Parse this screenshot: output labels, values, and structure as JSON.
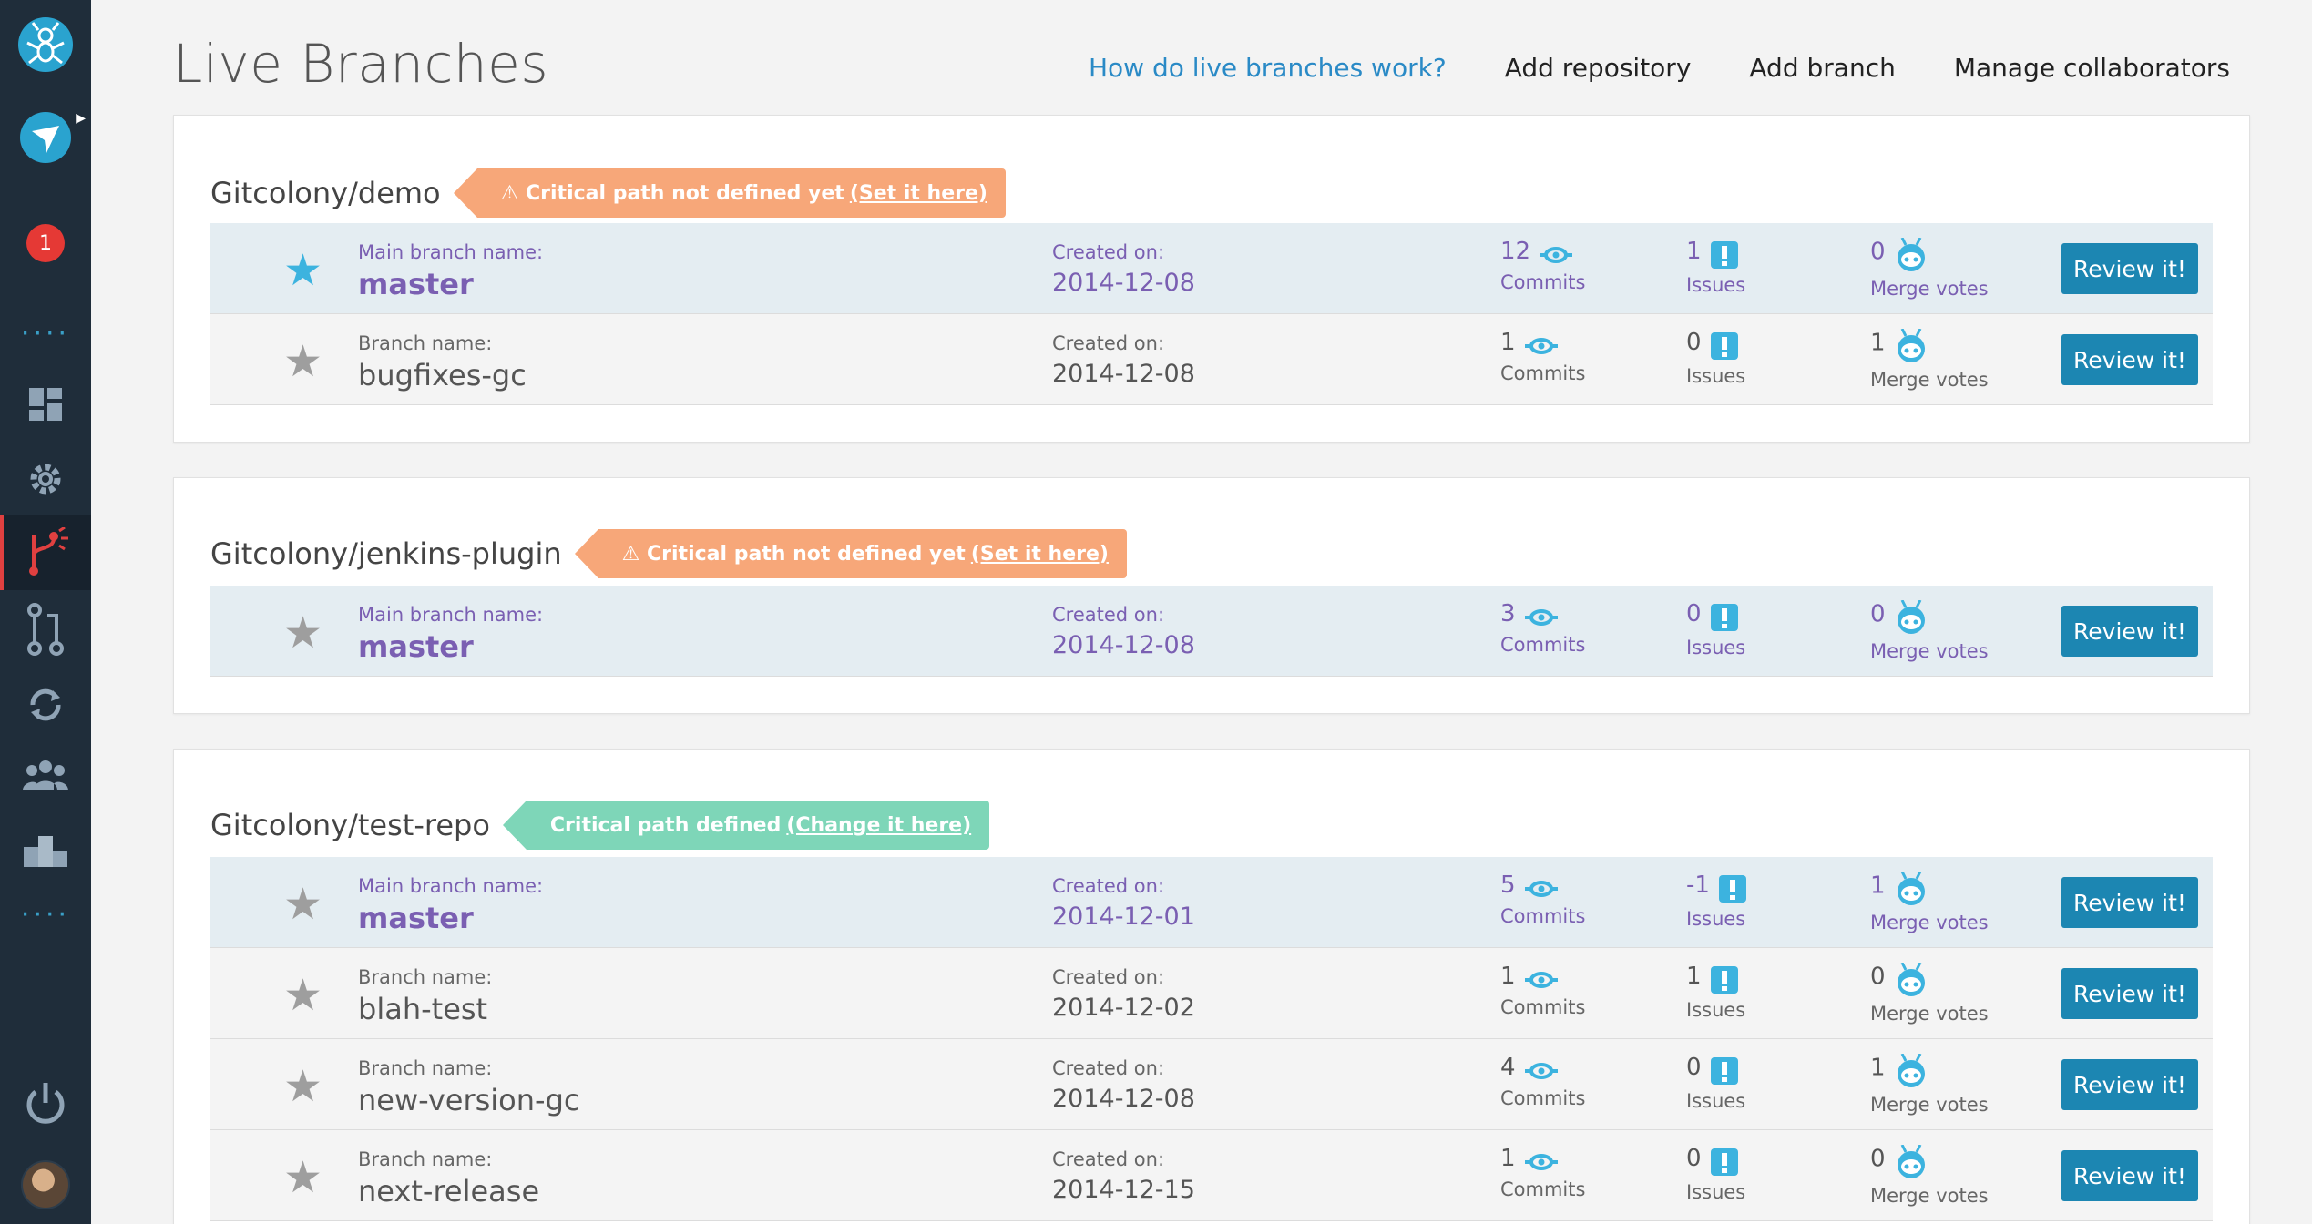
{
  "sidebar": {
    "logo_icon": "ant-logo-icon",
    "nav_icons": [
      "paper-plane-icon",
      "notification-badge",
      "dots-icon",
      "dashboard-icon",
      "gear-icon",
      "branch-icon",
      "pull-request-icon",
      "sync-icon",
      "team-icon",
      "leaderboard-icon",
      "dots-icon",
      "power-icon",
      "avatar"
    ],
    "notification_count": "1",
    "dots": "····"
  },
  "header": {
    "title": "Live Branches",
    "links": {
      "help": "How do live branches work?",
      "add_repo": "Add repository",
      "add_branch": "Add branch",
      "collaborators": "Manage collaborators"
    }
  },
  "colors": {
    "accent": "#1c86b2",
    "warn_tag": "#f7a779",
    "ok_tag": "#7ed6b8",
    "main_row": "#e4edf2",
    "purple_text": "#7a5fb2"
  },
  "labels": {
    "main_branch": "Main branch name:",
    "branch": "Branch name:",
    "created": "Created on:",
    "commits": "Commits",
    "issues": "Issues",
    "merge_votes": "Merge votes",
    "review": "Review it!"
  },
  "repos": [
    {
      "name": "Gitcolony/demo",
      "critical_text": "Critical path not defined yet",
      "critical_link": "(Set it here)",
      "branches": [
        {
          "name": "master",
          "created": "2014-12-08",
          "commits": "12",
          "issues": "1",
          "votes": "0"
        },
        {
          "name": "bugfixes-gc",
          "created": "2014-12-08",
          "commits": "1",
          "issues": "0",
          "votes": "1"
        }
      ]
    },
    {
      "name": "Gitcolony/jenkins-plugin",
      "critical_text": "Critical path not defined yet",
      "critical_link": "(Set it here)",
      "branches": [
        {
          "name": "master",
          "created": "2014-12-08",
          "commits": "3",
          "issues": "0",
          "votes": "0"
        }
      ]
    },
    {
      "name": "Gitcolony/test-repo",
      "critical_text": "Critical path defined",
      "critical_link": "(Change it here)",
      "branches": [
        {
          "name": "master",
          "created": "2014-12-01",
          "commits": "5",
          "issues": "-1",
          "votes": "1"
        },
        {
          "name": "blah-test",
          "created": "2014-12-02",
          "commits": "1",
          "issues": "1",
          "votes": "0"
        },
        {
          "name": "new-version-gc",
          "created": "2014-12-08",
          "commits": "4",
          "issues": "0",
          "votes": "1"
        },
        {
          "name": "next-release",
          "created": "2014-12-15",
          "commits": "1",
          "issues": "0",
          "votes": "0"
        }
      ]
    }
  ]
}
